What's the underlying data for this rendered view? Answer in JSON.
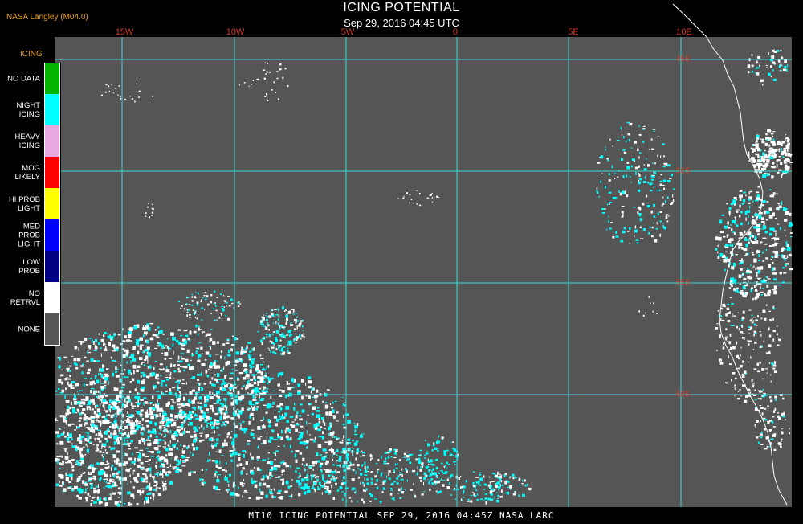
{
  "header": {
    "source_label": "NASA Langley (M04.0)",
    "title": "ICING POTENTIAL",
    "subtitle": "Sep 29, 2016 04:45 UTC"
  },
  "map": {
    "longitude_labels": [
      "15W",
      "10W",
      "5W",
      "0",
      "5E",
      "10E"
    ],
    "latitude_labels": [
      "45S",
      "50S",
      "55S",
      "60S"
    ],
    "colors": {
      "background": "#555555",
      "grid": "#3ad8d8",
      "night_icing": "#00ffff",
      "no_retrieval": "#ffffff",
      "coastline": "#ffffff"
    }
  },
  "legend": {
    "title": "ICING",
    "items": [
      {
        "label": "NO DATA",
        "color": "#00b400"
      },
      {
        "label": "NIGHT\nICING",
        "color": "#00ffff"
      },
      {
        "label": "HEAVY\nICING",
        "color": "#e8a8e0"
      },
      {
        "label": "MOG\nLIKELY",
        "color": "#ff0000"
      },
      {
        "label": "HI PROB\nLIGHT",
        "color": "#ffff00"
      },
      {
        "label": "MED PROB\nLIGHT",
        "color": "#0000ff"
      },
      {
        "label": "LOW\nPROB",
        "color": "#000080"
      },
      {
        "label": "NO\nRETRVL",
        "color": "#ffffff"
      },
      {
        "label": "NONE",
        "color": "#555555"
      }
    ]
  },
  "footer": {
    "caption": "MT10  ICING POTENTIAL   SEP 29, 2016 04:45Z   NASA LARC"
  }
}
